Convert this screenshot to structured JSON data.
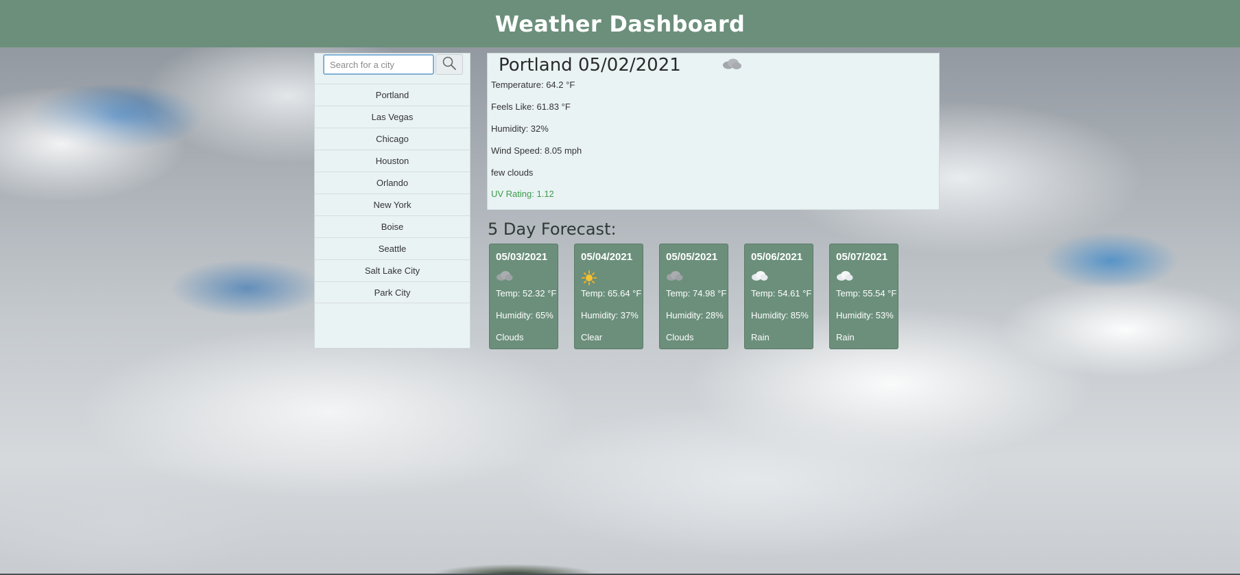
{
  "header": {
    "title": "Weather Dashboard"
  },
  "search": {
    "placeholder": "Search for a city"
  },
  "sidebar": {
    "cities": [
      "Portland",
      "Las Vegas",
      "Chicago",
      "Houston",
      "Orlando",
      "New York",
      "Boise",
      "Seattle",
      "Salt Lake City",
      "Park City"
    ]
  },
  "current": {
    "title": "Portland 05/02/2021",
    "icon": "clouds-icon",
    "temperature": "Temperature: 64.2 °F",
    "feels_like": "Feels Like: 61.83 °F",
    "humidity": "Humidity: 32%",
    "wind": "Wind Speed: 8.05 mph",
    "description": "few clouds",
    "uv": "UV Rating: 1.12",
    "uv_color": "#3c9a4a"
  },
  "forecast": {
    "heading": "5 Day Forecast:",
    "days": [
      {
        "date": "05/03/2021",
        "icon": "gray-cloud-icon",
        "temp": "Temp: 52.32 °F",
        "humidity": "Humidity: 65%",
        "desc": "Clouds"
      },
      {
        "date": "05/04/2021",
        "icon": "sun-icon",
        "temp": "Temp: 65.64 °F",
        "humidity": "Humidity: 37%",
        "desc": "Clear"
      },
      {
        "date": "05/05/2021",
        "icon": "gray-cloud-icon",
        "temp": "Temp: 74.98 °F",
        "humidity": "Humidity: 28%",
        "desc": "Clouds"
      },
      {
        "date": "05/06/2021",
        "icon": "white-cloud-icon",
        "temp": "Temp: 54.61 °F",
        "humidity": "Humidity: 85%",
        "desc": "Rain"
      },
      {
        "date": "05/07/2021",
        "icon": "white-cloud-icon",
        "temp": "Temp: 55.54 °F",
        "humidity": "Humidity: 53%",
        "desc": "Rain"
      }
    ]
  },
  "colors": {
    "header": "#6b8f7b",
    "card": "#6b8f7b",
    "panel": "#eaf3f4"
  }
}
